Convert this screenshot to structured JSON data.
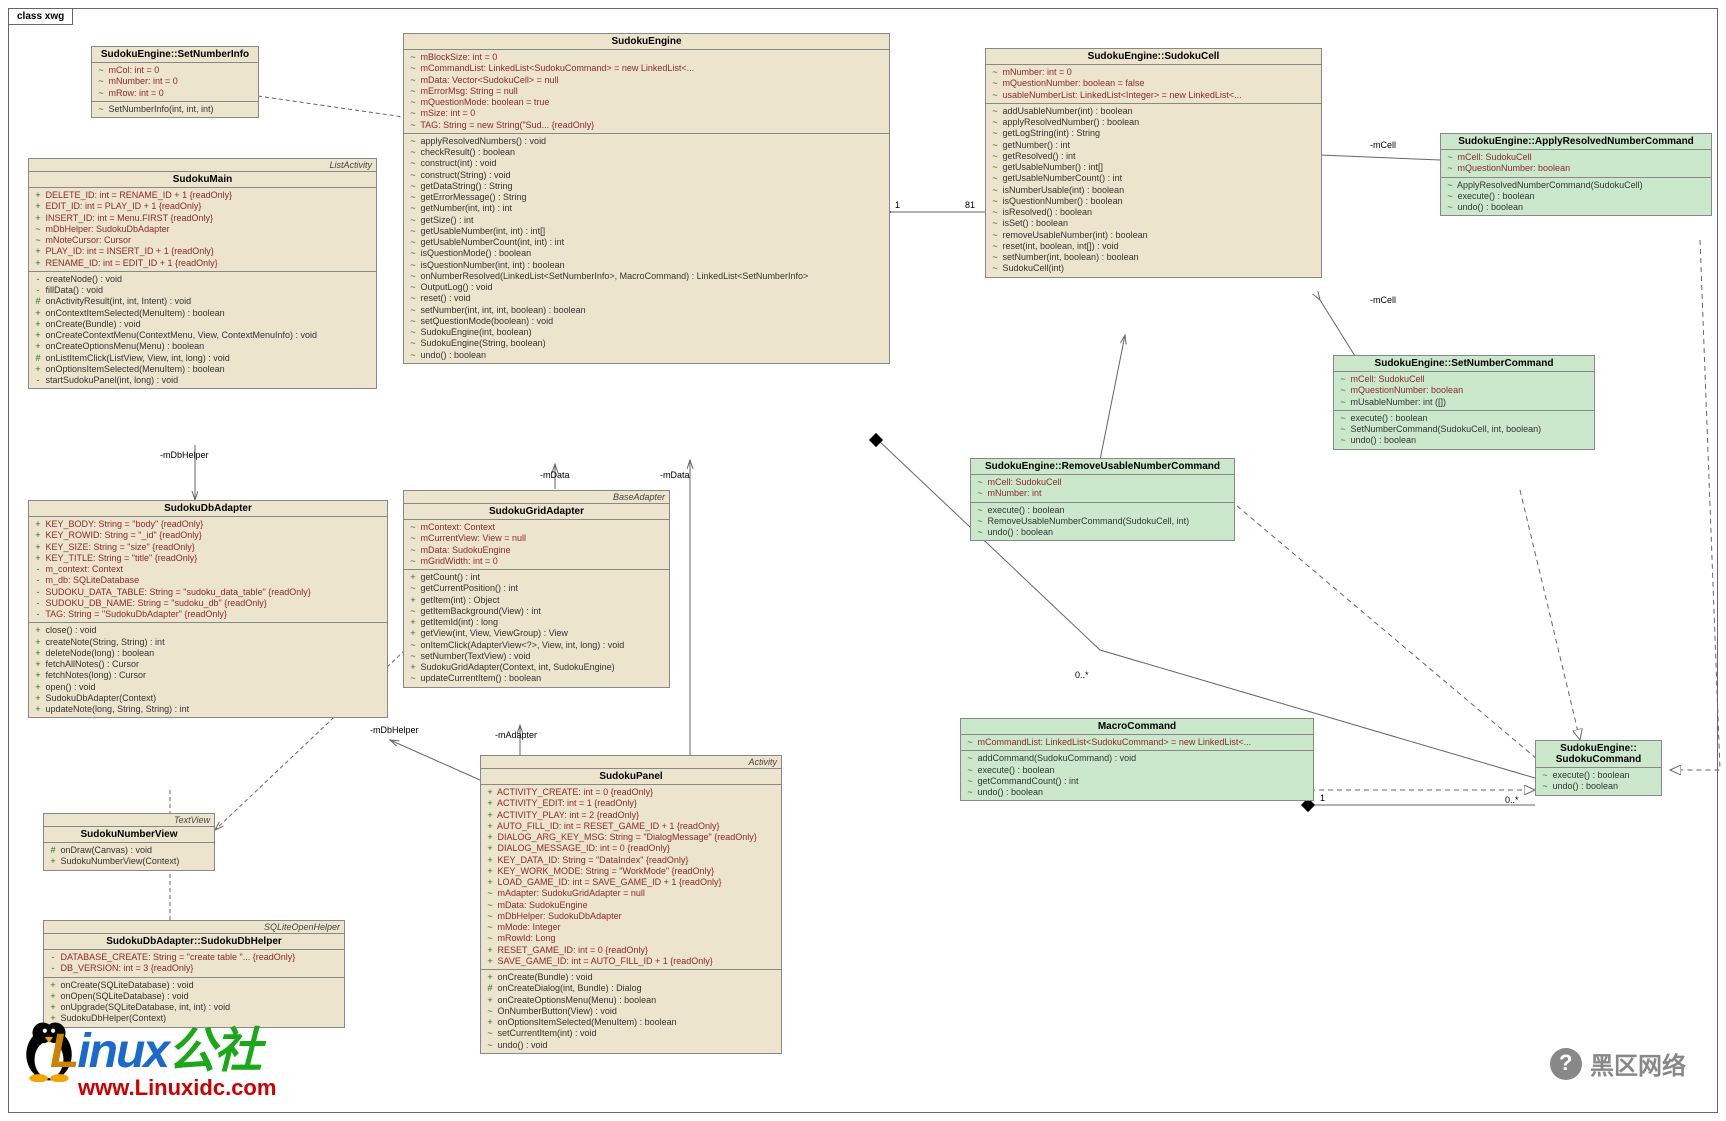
{
  "frameLabel": "class xwg",
  "classes": {
    "setNumberInfo": {
      "title": "SudokuEngine::SetNumberInfo",
      "attrs": [
        {
          "v": "~",
          "t": "mCol:  int = 0"
        },
        {
          "v": "~",
          "t": "mNumber:  int = 0"
        },
        {
          "v": "~",
          "t": "mRow:  int = 0"
        }
      ],
      "ops": [
        {
          "v": "~",
          "t": "SetNumberInfo(int, int, int)"
        }
      ]
    },
    "sudokuMain": {
      "stereo": "ListActivity",
      "title": "SudokuMain",
      "attrs": [
        {
          "v": "+",
          "t": "DELETE_ID:  int = RENAME_ID + 1 {readOnly}"
        },
        {
          "v": "+",
          "t": "EDIT_ID:  int = PLAY_ID + 1 {readOnly}"
        },
        {
          "v": "+",
          "t": "INSERT_ID:  int = Menu.FIRST {readOnly}"
        },
        {
          "v": "~",
          "t": "mDbHelper:  SudokuDbAdapter"
        },
        {
          "v": "~",
          "t": "mNoteCursor:  Cursor"
        },
        {
          "v": "+",
          "t": "PLAY_ID:  int = INSERT_ID + 1 {readOnly}"
        },
        {
          "v": "+",
          "t": "RENAME_ID:  int = EDIT_ID + 1 {readOnly}"
        }
      ],
      "ops": [
        {
          "v": "-",
          "t": "createNode() : void"
        },
        {
          "v": "-",
          "t": "fillData() : void"
        },
        {
          "v": "#",
          "t": "onActivityResult(int, int, Intent) : void"
        },
        {
          "v": "+",
          "t": "onContextItemSelected(MenuItem) : boolean"
        },
        {
          "v": "+",
          "t": "onCreate(Bundle) : void"
        },
        {
          "v": "+",
          "t": "onCreateContextMenu(ContextMenu, View, ContextMenuInfo) : void"
        },
        {
          "v": "+",
          "t": "onCreateOptionsMenu(Menu) : boolean"
        },
        {
          "v": "#",
          "t": "onListItemClick(ListView, View, int, long) : void"
        },
        {
          "v": "+",
          "t": "onOptionsItemSelected(MenuItem) : boolean"
        },
        {
          "v": "-",
          "t": "startSudokuPanel(int, long) : void"
        }
      ]
    },
    "sudokuEngine": {
      "title": "SudokuEngine",
      "attrs": [
        {
          "v": "~",
          "t": "mBlockSize:  int = 0"
        },
        {
          "v": "~",
          "t": "mCommandList:  LinkedList<SudokuCommand> = new LinkedList<..."
        },
        {
          "v": "~",
          "t": "mData:  Vector<SudokuCell> = null"
        },
        {
          "v": "~",
          "t": "mErrorMsg:  String = null"
        },
        {
          "v": "~",
          "t": "mQuestionMode:  boolean = true"
        },
        {
          "v": "~",
          "t": "mSize:  int = 0"
        },
        {
          "v": "~",
          "t": "TAG:  String = new String(\"Sud... {readOnly}"
        }
      ],
      "ops": [
        {
          "v": "~",
          "t": "applyResolvedNumbers() : void"
        },
        {
          "v": "~",
          "t": "checkResult() : boolean"
        },
        {
          "v": "~",
          "t": "construct(int) : void"
        },
        {
          "v": "~",
          "t": "construct(String) : void"
        },
        {
          "v": "~",
          "t": "getDataString() : String"
        },
        {
          "v": "~",
          "t": "getErrorMessage() : String"
        },
        {
          "v": "~",
          "t": "getNumber(int, int) : int"
        },
        {
          "v": "~",
          "t": "getSize() : int"
        },
        {
          "v": "~",
          "t": "getUsableNumber(int, int) : int[]"
        },
        {
          "v": "~",
          "t": "getUsableNumberCount(int, int) : int"
        },
        {
          "v": "~",
          "t": "isQuestionMode() : boolean"
        },
        {
          "v": "~",
          "t": "isQuestionNumber(int, int) : boolean"
        },
        {
          "v": "~",
          "t": "onNumberResolved(LinkedList<SetNumberInfo>, MacroCommand) : LinkedList<SetNumberInfo>"
        },
        {
          "v": "~",
          "t": "OutputLog() : void"
        },
        {
          "v": "~",
          "t": "reset() : void"
        },
        {
          "v": "~",
          "t": "setNumber(int, int, int, boolean) : boolean"
        },
        {
          "v": "~",
          "t": "setQuestionMode(boolean) : void"
        },
        {
          "v": "~",
          "t": "SudokuEngine(int, boolean)"
        },
        {
          "v": "~",
          "t": "SudokuEngine(String, boolean)"
        },
        {
          "v": "~",
          "t": "undo() : boolean"
        }
      ]
    },
    "sudokuCell": {
      "title": "SudokuEngine::SudokuCell",
      "attrs": [
        {
          "v": "~",
          "t": "mNumber:  int = 0"
        },
        {
          "v": "~",
          "t": "mQuestionNumber:  boolean = false"
        },
        {
          "v": "~",
          "t": "usableNumberList:  LinkedList<Integer> = new LinkedList<..."
        }
      ],
      "ops": [
        {
          "v": "~",
          "t": "addUsableNumber(int) : boolean"
        },
        {
          "v": "~",
          "t": "applyResolvedNumber() : boolean"
        },
        {
          "v": "~",
          "t": "getLogString(int) : String"
        },
        {
          "v": "~",
          "t": "getNumber() : int"
        },
        {
          "v": "~",
          "t": "getResolved() : int"
        },
        {
          "v": "~",
          "t": "getUsableNumber() : int[]"
        },
        {
          "v": "~",
          "t": "getUsableNumberCount() : int"
        },
        {
          "v": "~",
          "t": "isNumberUsable(int) : boolean"
        },
        {
          "v": "~",
          "t": "isQuestionNumber() : boolean"
        },
        {
          "v": "~",
          "t": "isResolved() : boolean"
        },
        {
          "v": "~",
          "t": "isSet() : boolean"
        },
        {
          "v": "~",
          "t": "removeUsableNumber(int) : boolean"
        },
        {
          "v": "~",
          "t": "reset(int, boolean, int[]) : void"
        },
        {
          "v": "~",
          "t": "setNumber(int, boolean) : boolean"
        },
        {
          "v": "~",
          "t": "SudokuCell(int)"
        }
      ]
    },
    "applyCmd": {
      "title": "SudokuEngine::ApplyResolvedNumberCommand",
      "attrs": [
        {
          "v": "~",
          "t": "mCell:  SudokuCell"
        },
        {
          "v": "~",
          "t": "mQuestionNumber:  boolean"
        }
      ],
      "ops": [
        {
          "v": "~",
          "t": "ApplyResolvedNumberCommand(SudokuCell)"
        },
        {
          "v": "~",
          "t": "execute() : boolean"
        },
        {
          "v": "~",
          "t": "undo() : boolean"
        }
      ]
    },
    "setNumCmd": {
      "title": "SudokuEngine::SetNumberCommand",
      "attrs": [
        {
          "v": "~",
          "t": "mCell:  SudokuCell"
        },
        {
          "v": "~",
          "t": "mQuestionNumber:  boolean"
        },
        {
          "v": "~",
          "t": "mUsableNumber:  int ([])"
        }
      ],
      "ops": [
        {
          "v": "~",
          "t": "execute() : boolean"
        },
        {
          "v": "~",
          "t": "SetNumberCommand(SudokuCell, int, boolean)"
        },
        {
          "v": "~",
          "t": "undo() : boolean"
        }
      ]
    },
    "removeCmd": {
      "title": "SudokuEngine::RemoveUsableNumberCommand",
      "attrs": [
        {
          "v": "~",
          "t": "mCell:  SudokuCell"
        },
        {
          "v": "~",
          "t": "mNumber:  int"
        }
      ],
      "ops": [
        {
          "v": "~",
          "t": "execute() : boolean"
        },
        {
          "v": "~",
          "t": "RemoveUsableNumberCommand(SudokuCell, int)"
        },
        {
          "v": "~",
          "t": "undo() : boolean"
        }
      ]
    },
    "macroCmd": {
      "title": "MacroCommand",
      "attrs": [
        {
          "v": "~",
          "t": "mCommandList:  LinkedList<SudokuCommand> = new LinkedList<..."
        }
      ],
      "ops": [
        {
          "v": "~",
          "t": "addCommand(SudokuCommand) : void"
        },
        {
          "v": "~",
          "t": "execute() : boolean"
        },
        {
          "v": "~",
          "t": "getCommandCount() : int"
        },
        {
          "v": "~",
          "t": "undo() : boolean"
        }
      ]
    },
    "sudokuCmd": {
      "title": "SudokuEngine::\nSudokuCommand",
      "ops": [
        {
          "v": "~",
          "t": "execute() : boolean"
        },
        {
          "v": "~",
          "t": "undo() : boolean"
        }
      ]
    },
    "dbAdapter": {
      "title": "SudokuDbAdapter",
      "attrs": [
        {
          "v": "+",
          "t": "KEY_BODY:  String = \"body\" {readOnly}"
        },
        {
          "v": "+",
          "t": "KEY_ROWID:  String = \"_id\" {readOnly}"
        },
        {
          "v": "+",
          "t": "KEY_SIZE:  String = \"size\" {readOnly}"
        },
        {
          "v": "+",
          "t": "KEY_TITLE:  String = \"title\" {readOnly}"
        },
        {
          "v": "-",
          "t": "m_context:  Context"
        },
        {
          "v": "-",
          "t": "m_db:  SQLiteDatabase"
        },
        {
          "v": "-",
          "t": "SUDOKU_DATA_TABLE:  String = \"sudoku_data_table\" {readOnly}"
        },
        {
          "v": "-",
          "t": "SUDOKU_DB_NAME:  String = \"sudoku_db\" {readOnly}"
        },
        {
          "v": "-",
          "t": "TAG:  String = \"SudokuDbAdapter\" {readOnly}"
        }
      ],
      "ops": [
        {
          "v": "+",
          "t": "close() : void"
        },
        {
          "v": "+",
          "t": "createNote(String, String) : int"
        },
        {
          "v": "+",
          "t": "deleteNode(long) : boolean"
        },
        {
          "v": "+",
          "t": "fetchAllNotes() : Cursor"
        },
        {
          "v": "+",
          "t": "fetchNotes(long) : Cursor"
        },
        {
          "v": "+",
          "t": "open() : void"
        },
        {
          "v": "+",
          "t": "SudokuDbAdapter(Context)"
        },
        {
          "v": "+",
          "t": "updateNote(long, String, String) : int"
        }
      ]
    },
    "numberView": {
      "stereo": "TextView",
      "title": "SudokuNumberView",
      "ops": [
        {
          "v": "#",
          "t": "onDraw(Canvas) : void"
        },
        {
          "v": "+",
          "t": "SudokuNumberView(Context)"
        }
      ]
    },
    "dbHelper": {
      "stereo": "SQLiteOpenHelper",
      "title": "SudokuDbAdapter::SudokuDbHelper",
      "attrs": [
        {
          "v": "-",
          "t": "DATABASE_CREATE:  String = \"create table \"... {readOnly}"
        },
        {
          "v": "-",
          "t": "DB_VERSION:  int = 3 {readOnly}"
        }
      ],
      "ops": [
        {
          "v": "+",
          "t": "onCreate(SQLiteDatabase) : void"
        },
        {
          "v": "+",
          "t": "onOpen(SQLiteDatabase) : void"
        },
        {
          "v": "+",
          "t": "onUpgrade(SQLiteDatabase, int, int) : void"
        },
        {
          "v": "+",
          "t": "SudokuDbHelper(Context)"
        }
      ]
    },
    "gridAdapter": {
      "stereo": "BaseAdapter",
      "title": "SudokuGridAdapter",
      "attrs": [
        {
          "v": "~",
          "t": "mContext:  Context"
        },
        {
          "v": "~",
          "t": "mCurrentView:  View = null"
        },
        {
          "v": "~",
          "t": "mData:  SudokuEngine"
        },
        {
          "v": "~",
          "t": "mGridWidth:  int = 0"
        }
      ],
      "ops": [
        {
          "v": "+",
          "t": "getCount() : int"
        },
        {
          "v": "~",
          "t": "getCurrentPosition() : int"
        },
        {
          "v": "+",
          "t": "getItem(int) : Object"
        },
        {
          "v": "~",
          "t": "getItemBackground(View) : int"
        },
        {
          "v": "+",
          "t": "getItemId(int) : long"
        },
        {
          "v": "+",
          "t": "getView(int, View, ViewGroup) : View"
        },
        {
          "v": "~",
          "t": "onItemClick(AdapterView<?>, View, int, long) : void"
        },
        {
          "v": "~",
          "t": "setNumber(TextView) : void"
        },
        {
          "v": "+",
          "t": "SudokuGridAdapter(Context, int, SudokuEngine)"
        },
        {
          "v": "~",
          "t": "updateCurrentItem() : boolean"
        }
      ]
    },
    "panel": {
      "stereo": "Activity",
      "title": "SudokuPanel",
      "attrs": [
        {
          "v": "+",
          "t": "ACTIVITY_CREATE:  int = 0 {readOnly}"
        },
        {
          "v": "+",
          "t": "ACTIVITY_EDIT:  int = 1 {readOnly}"
        },
        {
          "v": "+",
          "t": "ACTIVITY_PLAY:  int = 2 {readOnly}"
        },
        {
          "v": "+",
          "t": "AUTO_FILL_ID:  int = RESET_GAME_ID + 1 {readOnly}"
        },
        {
          "v": "+",
          "t": "DIALOG_ARG_KEY_MSG:  String = \"DialogMessage\" {readOnly}"
        },
        {
          "v": "+",
          "t": "DIALOG_MESSAGE_ID:  int = 0 {readOnly}"
        },
        {
          "v": "+",
          "t": "KEY_DATA_ID:  String = \"DataIndex\" {readOnly}"
        },
        {
          "v": "+",
          "t": "KEY_WORK_MODE:  String = \"WorkMode\" {readOnly}"
        },
        {
          "v": "+",
          "t": "LOAD_GAME_ID:  int = SAVE_GAME_ID + 1 {readOnly}"
        },
        {
          "v": "~",
          "t": "mAdapter:  SudokuGridAdapter = null"
        },
        {
          "v": "~",
          "t": "mData:  SudokuEngine"
        },
        {
          "v": "~",
          "t": "mDbHelper:  SudokuDbAdapter"
        },
        {
          "v": "~",
          "t": "mMode:  Integer"
        },
        {
          "v": "~",
          "t": "mRowId:  Long"
        },
        {
          "v": "+",
          "t": "RESET_GAME_ID:  int = 0 {readOnly}"
        },
        {
          "v": "+",
          "t": "SAVE_GAME_ID:  int = AUTO_FILL_ID + 1 {readOnly}"
        }
      ],
      "ops": [
        {
          "v": "+",
          "t": "onCreate(Bundle) : void"
        },
        {
          "v": "#",
          "t": "onCreateDialog(int, Bundle) : Dialog"
        },
        {
          "v": "+",
          "t": "onCreateOptionsMenu(Menu) : boolean"
        },
        {
          "v": "~",
          "t": "OnNumberButton(View) : void"
        },
        {
          "v": "+",
          "t": "onOptionsItemSelected(MenuItem) : boolean"
        },
        {
          "v": "~",
          "t": "setCurrentItem(int) : void"
        },
        {
          "v": "~",
          "t": "undo() : void"
        }
      ]
    }
  },
  "labels": {
    "mCell1": "-mCell",
    "mCell2": "-mCell",
    "mData1": "-mData",
    "mData2": "-mData",
    "mDbHelper1": "-mDbHelper",
    "mDbHelper2": "-mDbHelper",
    "mAdapter": "-mAdapter",
    "m81": "81",
    "m1a": "1",
    "m1b": "1",
    "m0a": "0..*",
    "m0b": "0..*"
  },
  "wm": {
    "linux": "Linux",
    "gs": "公社",
    "url": "www.Linuxidc.com",
    "hei": "黑区网络"
  }
}
